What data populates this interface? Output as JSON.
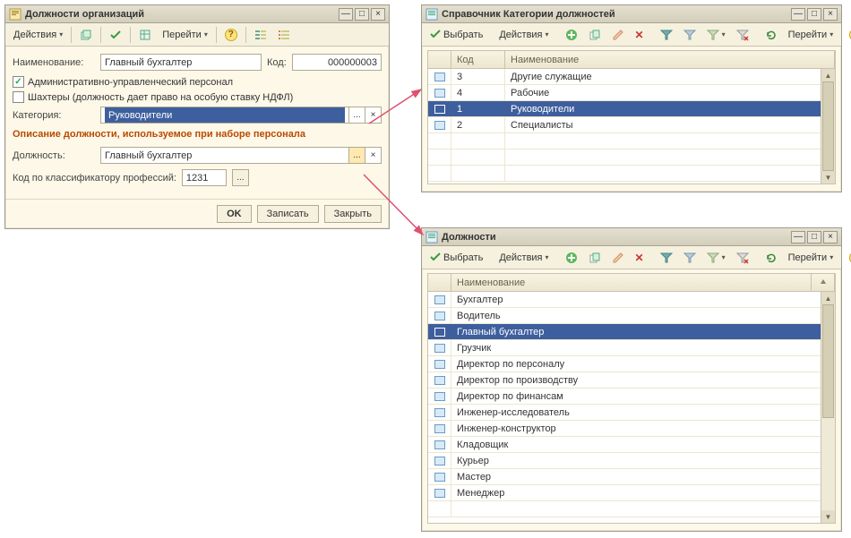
{
  "icons": {
    "dropdown": "▾",
    "minimize": "—",
    "maximize": "□",
    "close": "×",
    "ellipsis": "...",
    "clear": "×",
    "help": "?",
    "check": "✓",
    "up": "▲",
    "down": "▼"
  },
  "colors": {
    "selection_bg": "#3e5f9e",
    "accent_text": "#b94a00"
  },
  "win1": {
    "title": "Должности организаций",
    "toolbar": {
      "actions_label": "Действия",
      "goto_label": "Перейти"
    },
    "form": {
      "name_label": "Наименование:",
      "name_value": "Главный бухгалтер",
      "code_label": "Код:",
      "code_value": "000000003",
      "chk1_label": "Административно-управленческий персонал",
      "chk1_checked": true,
      "chk2_label": "Шахтеры (должность дает право на особую ставку НДФЛ)",
      "chk2_checked": false,
      "category_label": "Категория:",
      "category_value": "Руководители",
      "section_label": "Описание должности, используемое при наборе персонала",
      "position_label": "Должность:",
      "position_value": "Главный бухгалтер",
      "classifier_label": "Код по классификатору профессий:",
      "classifier_value": "1231"
    },
    "buttons": {
      "ok": "OK",
      "save": "Записать",
      "close": "Закрыть"
    }
  },
  "win2": {
    "title": "Справочник Категории должностей",
    "toolbar": {
      "select_label": "Выбрать",
      "actions_label": "Действия",
      "goto_label": "Перейти"
    },
    "table": {
      "col_code": "Код",
      "col_name": "Наименование",
      "rows": [
        {
          "code": "3",
          "name": "Другие служащие",
          "selected": false
        },
        {
          "code": "4",
          "name": "Рабочие",
          "selected": false
        },
        {
          "code": "1",
          "name": "Руководители",
          "selected": true
        },
        {
          "code": "2",
          "name": "Специалисты",
          "selected": false
        }
      ]
    }
  },
  "win3": {
    "title": "Должности",
    "toolbar": {
      "select_label": "Выбрать",
      "actions_label": "Действия",
      "goto_label": "Перейти"
    },
    "table": {
      "col_name": "Наименование",
      "rows": [
        {
          "name": "Бухгалтер",
          "selected": false
        },
        {
          "name": "Водитель",
          "selected": false
        },
        {
          "name": "Главный бухгалтер",
          "selected": true
        },
        {
          "name": "Грузчик",
          "selected": false
        },
        {
          "name": "Директор по персоналу",
          "selected": false
        },
        {
          "name": "Директор по производству",
          "selected": false
        },
        {
          "name": "Директор по финансам",
          "selected": false
        },
        {
          "name": "Инженер-исследователь",
          "selected": false
        },
        {
          "name": "Инженер-конструктор",
          "selected": false
        },
        {
          "name": "Кладовщик",
          "selected": false
        },
        {
          "name": "Курьер",
          "selected": false
        },
        {
          "name": "Мастер",
          "selected": false
        },
        {
          "name": "Менеджер",
          "selected": false
        }
      ]
    }
  }
}
